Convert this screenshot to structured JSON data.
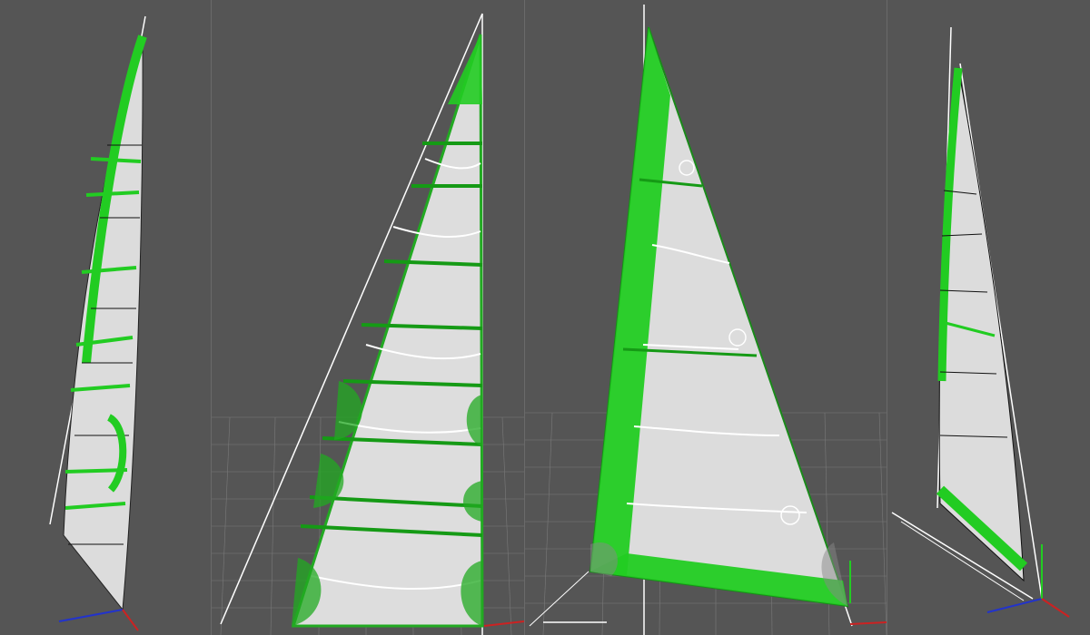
{
  "app": {
    "name": ""
  },
  "colors": {
    "background": "#555555",
    "sail_cloth": "#d9d9d9",
    "reinforcement": "#22cc22",
    "reinforcement_dark": "#159a15",
    "grid": "#7a7a7a",
    "axis_x": "#cc2222",
    "axis_y": "#22cc22",
    "axis_z": "#2233cc",
    "lines": "#ffffff"
  },
  "viewports": [
    {
      "name": "side-view-left",
      "view": "side"
    },
    {
      "name": "front-view-mainsail",
      "view": "front"
    },
    {
      "name": "front-view-headsail",
      "view": "front"
    },
    {
      "name": "side-view-right",
      "view": "side"
    }
  ],
  "icons": {
    "axis_gizmo": "axis-gizmo-icon",
    "batten_marker": "batten-marker-icon"
  }
}
